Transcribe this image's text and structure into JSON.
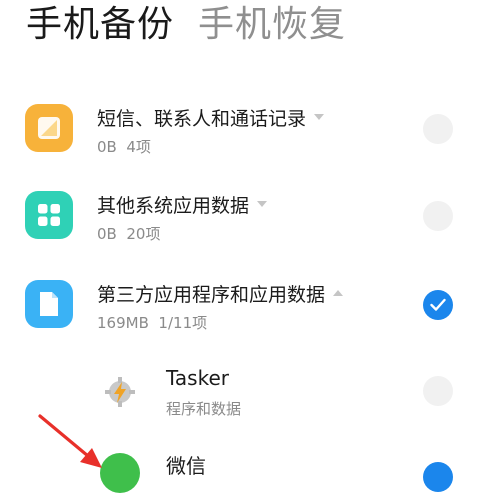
{
  "header": {
    "tab_backup": "手机备份",
    "tab_restore": "手机恢复"
  },
  "items": [
    {
      "title": "短信、联系人和通话记录",
      "size": "0B",
      "count": "4项",
      "icon": "message-icon",
      "icon_color": "#f7b23a",
      "checked": false
    },
    {
      "title": "其他系统应用数据",
      "size": "0B",
      "count": "20项",
      "icon": "grid-icon",
      "icon_color": "#2fd1b6",
      "checked": false
    },
    {
      "title": "第三方应用程序和应用数据",
      "size": "169MB",
      "count": "1/11项",
      "icon": "document-icon",
      "icon_color": "#3ab2f5",
      "checked": true
    }
  ],
  "sub_items": [
    {
      "title": "Tasker",
      "subtitle": "程序和数据",
      "icon": "tasker-bolt-icon",
      "checked": false
    },
    {
      "title": "微信",
      "icon": "wechat-icon",
      "icon_color": "#3fbf4b",
      "checked": true
    }
  ],
  "colors": {
    "accent": "#1b86ec",
    "annotation_arrow": "#e8302a"
  }
}
